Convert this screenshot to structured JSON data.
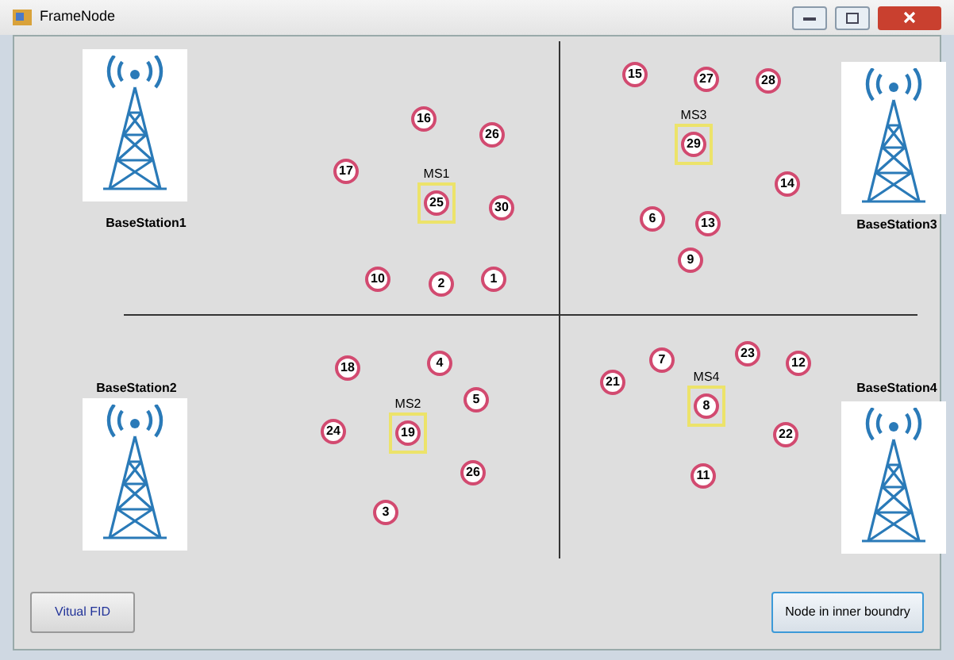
{
  "window": {
    "title": "FrameNode"
  },
  "base_stations": [
    {
      "label": "BaseStation1"
    },
    {
      "label": "BaseStation3"
    },
    {
      "label": "BaseStation2"
    },
    {
      "label": "BaseStation4"
    }
  ],
  "nodes": [
    {
      "label": "16",
      "kind": "node"
    },
    {
      "label": "26",
      "kind": "node"
    },
    {
      "label": "17",
      "kind": "node"
    },
    {
      "label": "25",
      "kind": "mobile",
      "station": "MS1"
    },
    {
      "label": "30",
      "kind": "node"
    },
    {
      "label": "10",
      "kind": "node"
    },
    {
      "label": "2",
      "kind": "node"
    },
    {
      "label": "1",
      "kind": "node"
    },
    {
      "label": "15",
      "kind": "node"
    },
    {
      "label": "27",
      "kind": "node"
    },
    {
      "label": "28",
      "kind": "node"
    },
    {
      "label": "29",
      "kind": "mobile",
      "station": "MS3"
    },
    {
      "label": "14",
      "kind": "node"
    },
    {
      "label": "6",
      "kind": "node"
    },
    {
      "label": "13",
      "kind": "node"
    },
    {
      "label": "9",
      "kind": "node"
    },
    {
      "label": "18",
      "kind": "node"
    },
    {
      "label": "4",
      "kind": "node"
    },
    {
      "label": "5",
      "kind": "node"
    },
    {
      "label": "24",
      "kind": "node"
    },
    {
      "label": "19",
      "kind": "mobile",
      "station": "MS2"
    },
    {
      "label": "26",
      "kind": "node"
    },
    {
      "label": "3",
      "kind": "node"
    },
    {
      "label": "21",
      "kind": "node"
    },
    {
      "label": "7",
      "kind": "node"
    },
    {
      "label": "23",
      "kind": "node"
    },
    {
      "label": "12",
      "kind": "node"
    },
    {
      "label": "8",
      "kind": "mobile",
      "station": "MS4"
    },
    {
      "label": "22",
      "kind": "node"
    },
    {
      "label": "11",
      "kind": "node"
    }
  ],
  "buttons": [
    {
      "label": "Vitual FID"
    },
    {
      "label": "Node in inner boundry"
    }
  ]
}
